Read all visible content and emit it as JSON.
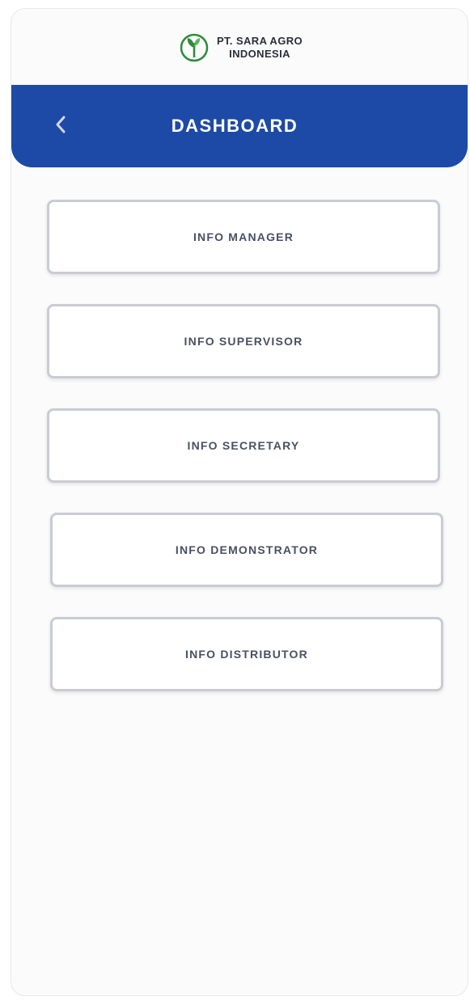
{
  "brand": {
    "logo_icon": "plant-leaf-icon",
    "name_line1": "PT. SARA AGRO",
    "name_line2": "INDONESIA",
    "accent_color": "#2e8b3a"
  },
  "header": {
    "title": "DASHBOARD",
    "back_icon": "chevron-left-icon",
    "background_color": "#1d4aa6"
  },
  "menu": {
    "items": [
      {
        "label": "INFO MANAGER"
      },
      {
        "label": "INFO SUPERVISOR"
      },
      {
        "label": "INFO SECRETARY"
      },
      {
        "label": "INFO DEMONSTRATOR"
      },
      {
        "label": "INFO DISTRIBUTOR"
      }
    ]
  }
}
